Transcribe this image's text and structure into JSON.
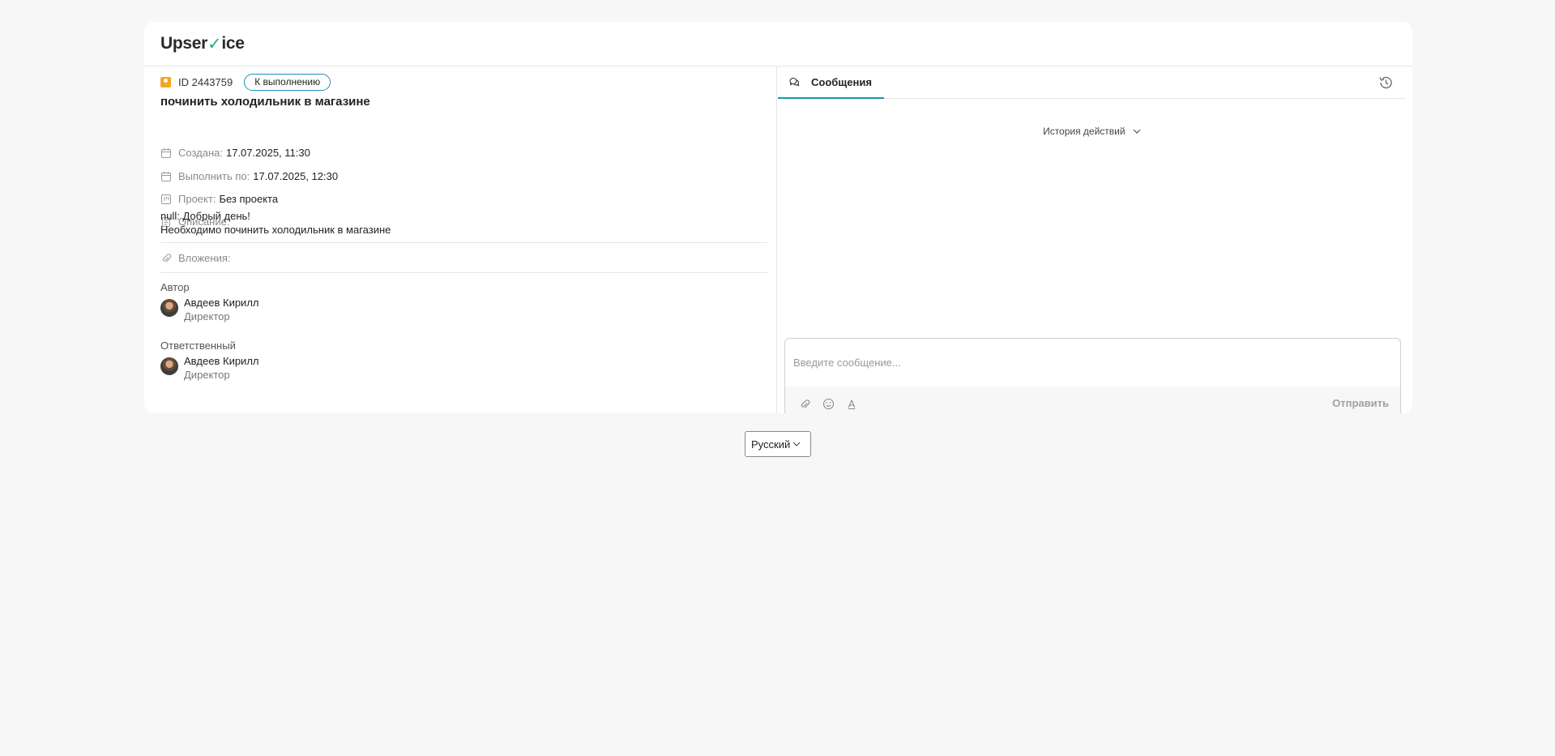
{
  "brand": {
    "logo_pre": "Upser",
    "logo_mark": "✓",
    "logo_post": "ice"
  },
  "task": {
    "id_label": "ID 2443759",
    "status": "К выполнению",
    "title": "починить холодильник в магазине",
    "created_label": "Создана:",
    "created_value": "17.07.2025, 11:30",
    "due_label": "Выполнить по:",
    "due_value": "17.07.2025, 12:30",
    "project_label": "Проект:",
    "project_value": "Без проекта",
    "description_label": "Описание:",
    "description_line1": "null: Добрый день!",
    "description_line2": "Необходимо починить холодильник в магазине",
    "attachments_label": "Вложения:"
  },
  "people": {
    "author_label": "Автор",
    "author": {
      "name": "Авдеев Кирилл",
      "role": "Директор"
    },
    "assignee_label": "Ответственный",
    "assignee": {
      "name": "Авдеев Кирилл",
      "role": "Директор"
    }
  },
  "messages": {
    "tab_label": "Сообщения",
    "history_toggle": "История действий",
    "input_placeholder": "Введите сообщение...",
    "send_label": "Отправить",
    "format_glyph": "A"
  },
  "footer": {
    "language": "Русский"
  },
  "colors": {
    "accent": "#179aa8",
    "status_border": "#1e8fc2",
    "logo_check": "#22b573",
    "id_icon": "#f5a623"
  }
}
